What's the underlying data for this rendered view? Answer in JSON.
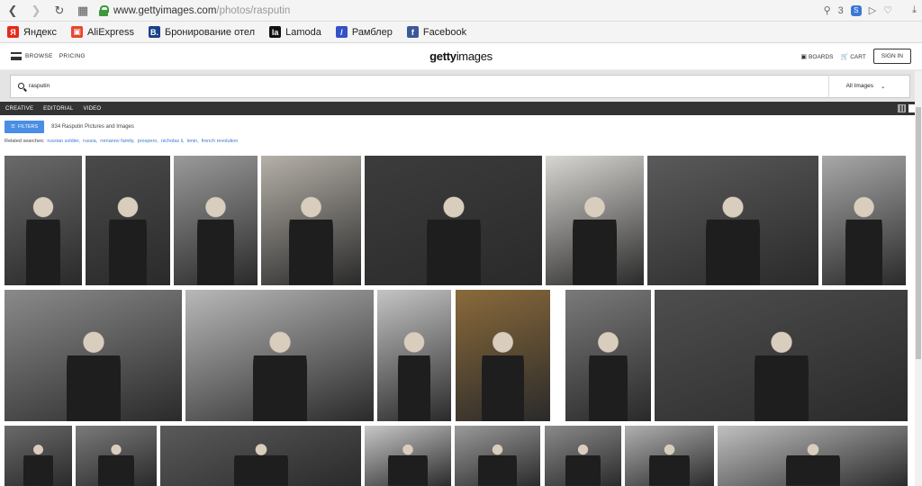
{
  "browser": {
    "url_host": "www.gettyimages.com",
    "url_path": "/photos/rasputin",
    "tab_count": "3"
  },
  "bookmarks": [
    {
      "label": "Яндекс",
      "icon": "yandex-icon",
      "color": "#e8281c",
      "glyph": "Я"
    },
    {
      "label": "AliExpress",
      "icon": "aliexpress-icon",
      "color": "#e8452c",
      "glyph": "▣"
    },
    {
      "label": "Бронирование отел",
      "icon": "booking-icon",
      "color": "#1a3f8c",
      "glyph": "B."
    },
    {
      "label": "Lamoda",
      "icon": "lamoda-icon",
      "color": "#111111",
      "glyph": "la"
    },
    {
      "label": "Рамблер",
      "icon": "rambler-icon",
      "color": "#3550c8",
      "glyph": "/"
    },
    {
      "label": "Facebook",
      "icon": "facebook-icon",
      "color": "#3b5998",
      "glyph": "f"
    }
  ],
  "header": {
    "browse": "BROWSE",
    "pricing": "PRICING",
    "logo_bold": "getty",
    "logo_rest": "images",
    "boards": "BOARDS",
    "cart": "CART",
    "signin": "SIGN IN"
  },
  "search": {
    "query": "rasputin",
    "scope": "All Images"
  },
  "categories": [
    "CREATIVE",
    "EDITORIAL",
    "VIDEO"
  ],
  "results": {
    "filters_label": "FILTERS",
    "count_text": "834 Rasputin Pictures and Images",
    "related_label": "Related searches:",
    "related": [
      "russian soldier",
      "russia",
      "romanov family",
      "prospero",
      "nicholas ii",
      "lenin",
      "french revolution"
    ]
  }
}
